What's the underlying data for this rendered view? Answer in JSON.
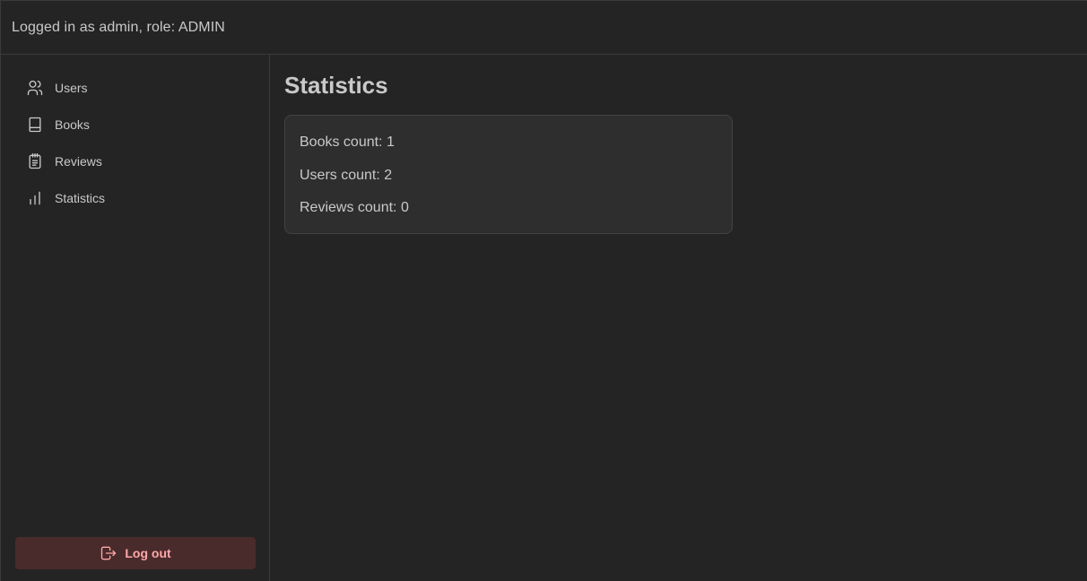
{
  "header": {
    "session_text": "Logged in as admin, role: ADMIN"
  },
  "sidebar": {
    "items": [
      {
        "label": "Users",
        "icon": "users-icon"
      },
      {
        "label": "Books",
        "icon": "book-icon"
      },
      {
        "label": "Reviews",
        "icon": "notes-icon"
      },
      {
        "label": "Statistics",
        "icon": "bar-chart-icon"
      }
    ],
    "logout_label": "Log out"
  },
  "main": {
    "title": "Statistics",
    "stats": {
      "books": "Books count: 1",
      "users": "Users count: 2",
      "reviews": "Reviews count: 0"
    }
  },
  "colors": {
    "background": "#242424",
    "border": "#3a3a3a",
    "card": "#2e2e2e",
    "text": "#c9c9c9",
    "logout_bg": "#4a2b2c",
    "logout_text": "#ffa8a8"
  }
}
